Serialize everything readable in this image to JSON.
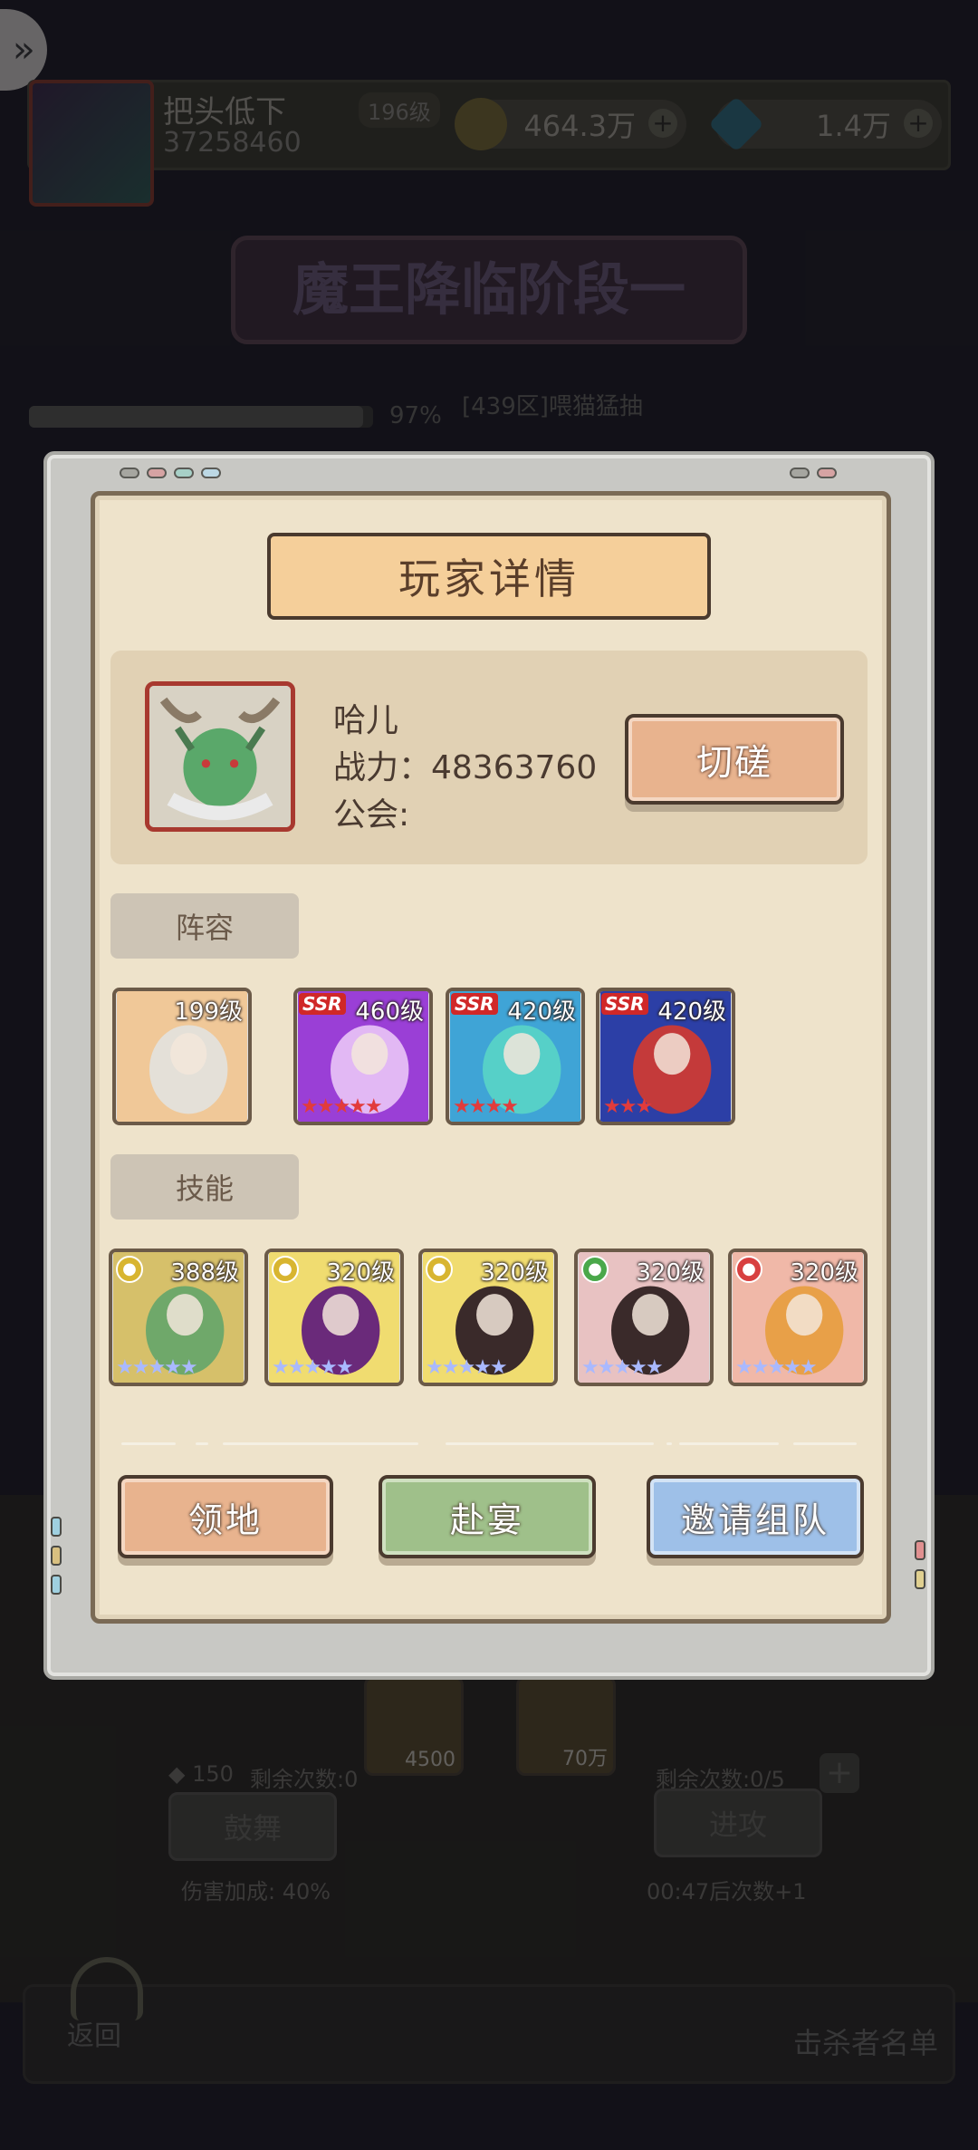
{
  "background": {
    "player_name": "把头低下",
    "player_level": "196级",
    "player_power": "37258460",
    "gold": "464.3万",
    "gems": "1.4万",
    "banner_title": "魔王降临阶段一",
    "progress_pct": "97%",
    "progress_value": 0.97,
    "region_text": "[439区]喂猫猛抽",
    "reward_1": "4500",
    "reward_2": "70万",
    "inspire_cost": "150",
    "inspire_remaining": "剩余次数:0",
    "attack_remaining": "剩余次数:0/5",
    "inspire_button": "鼓舞",
    "attack_button": "进攻",
    "damage_bonus": "伤害加成: 40%",
    "regen_timer": "00:47后次数+1",
    "back_label": "返回",
    "killers_label": "击杀者名单"
  },
  "modal": {
    "title": "玩家详情",
    "player": {
      "name": "哈儿",
      "power_line": "战力：48363760",
      "guild_line": "公会:"
    },
    "spar_button": "切磋",
    "lineup_tab": "阵容",
    "skills_tab": "技能",
    "lineup": [
      {
        "level": "199级",
        "ssr": "",
        "stars": 0,
        "colors": [
          "#f0c898",
          "#e4e0d8"
        ]
      },
      {
        "level": "460级",
        "ssr": "SSR",
        "stars": 5,
        "colors": [
          "#9a3fd6",
          "#e2b8f4"
        ]
      },
      {
        "level": "420级",
        "ssr": "SSR",
        "stars": 4,
        "colors": [
          "#3fa4d6",
          "#56d0c8"
        ]
      },
      {
        "level": "420级",
        "ssr": "SSR",
        "stars": 3,
        "colors": [
          "#2c3fa6",
          "#c43a3a"
        ]
      }
    ],
    "skills": [
      {
        "level": "388级",
        "element": "yellow",
        "stars": 5,
        "colors": [
          "#d6c06a",
          "#6fa86a"
        ]
      },
      {
        "level": "320级",
        "element": "yellow",
        "stars": 5,
        "colors": [
          "#f0dc70",
          "#6a2a7a"
        ]
      },
      {
        "level": "320级",
        "element": "yellow",
        "stars": 5,
        "colors": [
          "#f0dc70",
          "#3a2a2a"
        ]
      },
      {
        "level": "320级",
        "element": "green",
        "stars": 5,
        "colors": [
          "#e8c2c2",
          "#3a2a2a"
        ]
      },
      {
        "level": "320级",
        "element": "red",
        "stars": 5,
        "colors": [
          "#f0b8a8",
          "#e8a048"
        ]
      }
    ],
    "buttons": {
      "territory": "领地",
      "banquet": "赴宴",
      "invite_team": "邀请组队"
    }
  },
  "icons": {
    "share": "share-arrow-icon",
    "gold": "gold-coin-icon",
    "gem": "diamond-icon",
    "plus": "plus-icon"
  }
}
